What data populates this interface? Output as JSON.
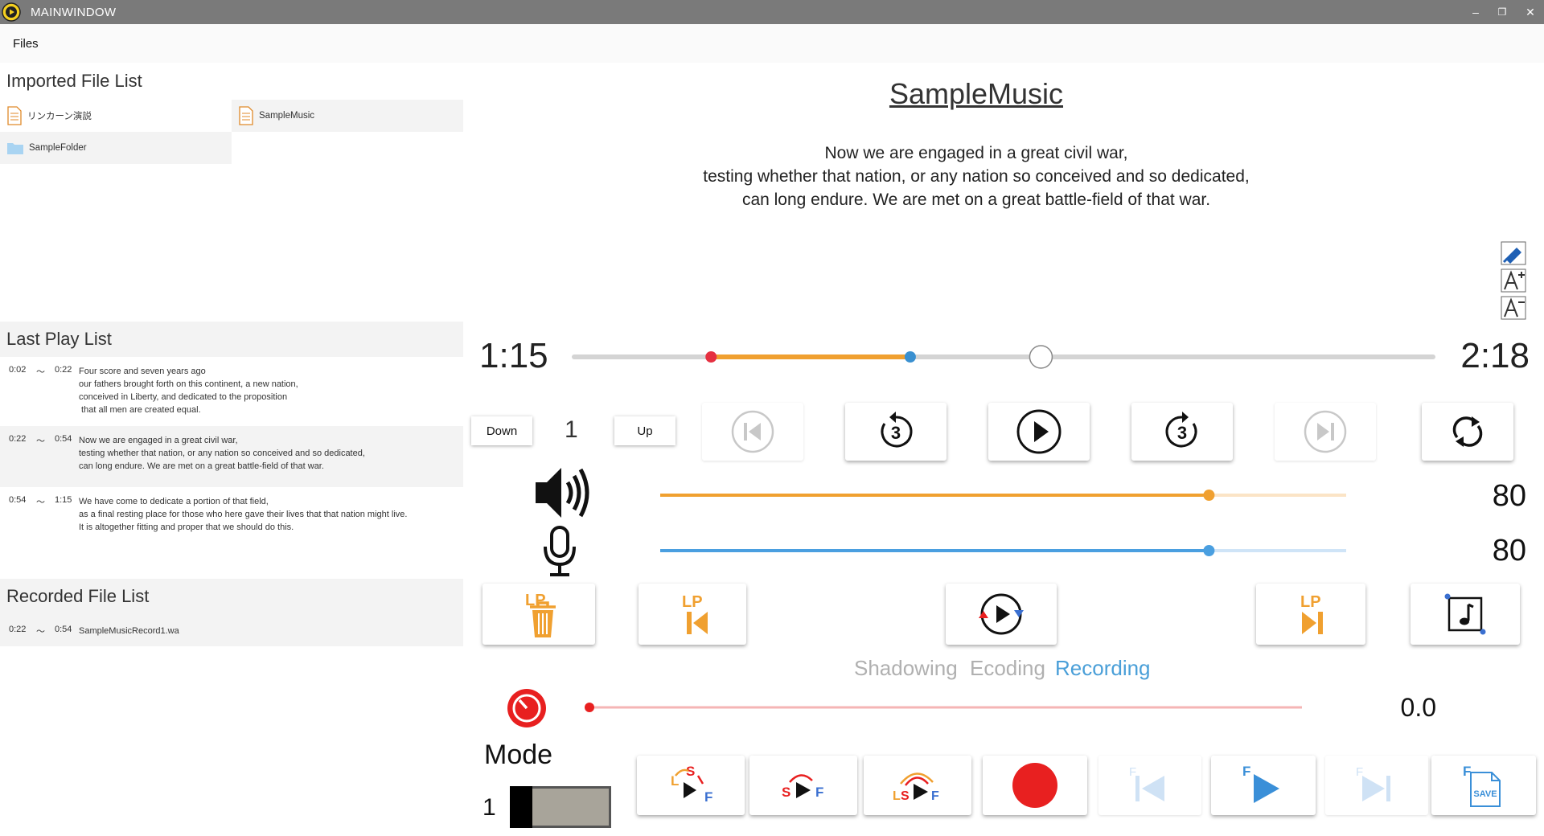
{
  "window": {
    "title": "MAINWINDOW",
    "minimize": "–",
    "restore": "❐",
    "close": "✕"
  },
  "menu": {
    "files": "Files"
  },
  "imported": {
    "title": "Imported File List",
    "items": [
      {
        "name": "リンカーン演説",
        "type": "file"
      },
      {
        "name": "SampleMusic",
        "type": "file"
      },
      {
        "name": "SampleFolder",
        "type": "folder"
      }
    ]
  },
  "last_play": {
    "title": "Last Play List",
    "rows": [
      {
        "start": "0:02",
        "sep": "〜",
        "end": "0:22",
        "text": "Four score and seven years ago\nour fathers brought forth on this continent, a new nation,\nconceived in Liberty, and dedicated to the proposition\n that all men are created equal."
      },
      {
        "start": "0:22",
        "sep": "〜",
        "end": "0:54",
        "text": "Now we are engaged in a great civil war,\ntesting whether that nation, or any nation so conceived and so dedicated,\ncan long endure. We are met on a great battle-field of that war."
      },
      {
        "start": "0:54",
        "sep": "〜",
        "end": "1:15",
        "text": "We have come to dedicate a portion of that field,\nas a final resting place for those who here gave their lives that that nation might live.\nIt is altogether fitting and proper that we should do this."
      }
    ]
  },
  "recorded": {
    "title": "Recorded File List",
    "rows": [
      {
        "start": "0:22",
        "sep": "〜",
        "end": "0:54",
        "name": "SampleMusicRecord1.wa"
      }
    ]
  },
  "player": {
    "track_title": "SampleMusic",
    "lyrics": [
      "Now we are engaged in a great civil war,",
      "testing whether that nation, or any nation so conceived and so dedicated,",
      "can long endure. We are met on a great battle-field of that war."
    ],
    "current_time": "1:15",
    "total_time": "2:18",
    "progress": {
      "loop_start_sec": 22,
      "loop_end_sec": 54,
      "position_sec": 75,
      "total_sec": 138
    },
    "speed": {
      "down_label": "Down",
      "value": "1",
      "up_label": "Up"
    },
    "volume": {
      "value": "80",
      "level": 80
    },
    "mic": {
      "value": "80",
      "level": 80
    },
    "modes": [
      "Shadowing",
      "Ecoding",
      "Recording"
    ],
    "active_mode": "Recording",
    "record_level": {
      "value": "0.0",
      "level": 0
    },
    "mode_label": "Mode",
    "mode_value": "1",
    "colors": {
      "accent_orange": "#f0a030",
      "accent_blue": "#4a9fe0",
      "record_red": "#e82020",
      "mode_active": "#4a9fd8",
      "mode_inactive": "#b0b0b0"
    }
  }
}
